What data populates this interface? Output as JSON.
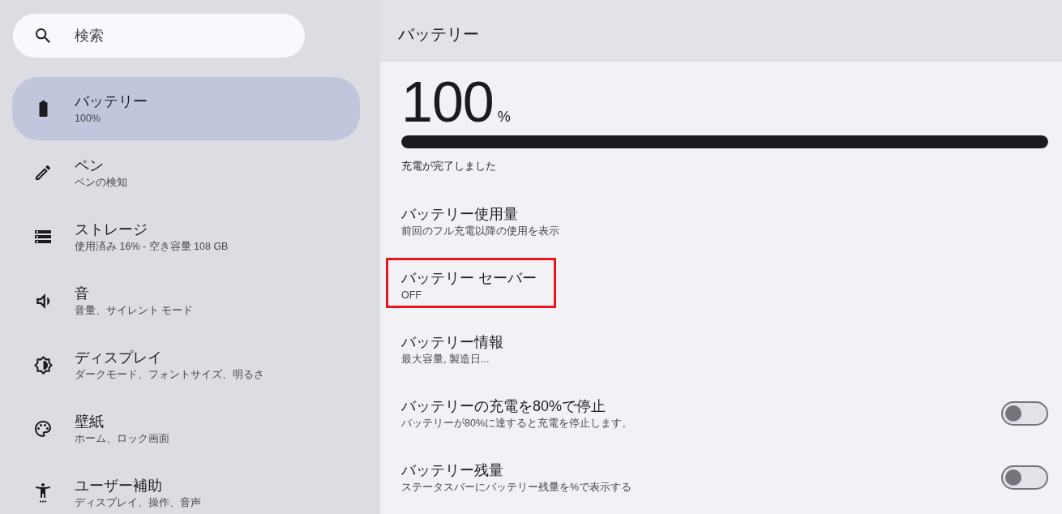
{
  "sidebar": {
    "search": {
      "placeholder": "検索"
    },
    "items": [
      {
        "title": "バッテリー",
        "subtitle": "100%",
        "selected": true
      },
      {
        "title": "ペン",
        "subtitle": "ペンの検知",
        "selected": false
      },
      {
        "title": "ストレージ",
        "subtitle": "使用済み 16% - 空き容量 108 GB",
        "selected": false
      },
      {
        "title": "音",
        "subtitle": "音量、サイレント モード",
        "selected": false
      },
      {
        "title": "ディスプレイ",
        "subtitle": "ダークモード、フォントサイズ、明るさ",
        "selected": false
      },
      {
        "title": "壁紙",
        "subtitle": "ホーム、ロック画面",
        "selected": false
      },
      {
        "title": "ユーザー補助",
        "subtitle": "ディスプレイ、操作、音声",
        "selected": false
      }
    ]
  },
  "header": {
    "title": "バッテリー"
  },
  "battery": {
    "percentage": "100",
    "unit": "%",
    "level": 1,
    "status": "充電が完了しました"
  },
  "settings": [
    {
      "kind": "link",
      "title": "バッテリー使用量",
      "subtitle": "前回のフル充電以降の使用を表示",
      "highlighted": false
    },
    {
      "kind": "link",
      "title": "バッテリー セーバー",
      "subtitle": "OFF",
      "highlighted": true
    },
    {
      "kind": "link",
      "title": "バッテリー情報",
      "subtitle": "最大容量, 製造日...",
      "highlighted": false
    },
    {
      "kind": "toggle",
      "title": "バッテリーの充電を80%で停止",
      "subtitle": "バッテリーが80%に達すると充電を停止します。",
      "on": false
    },
    {
      "kind": "toggle",
      "title": "バッテリー残量",
      "subtitle": "ステータスバーにバッテリー残量を%で表示する",
      "on": false
    }
  ]
}
